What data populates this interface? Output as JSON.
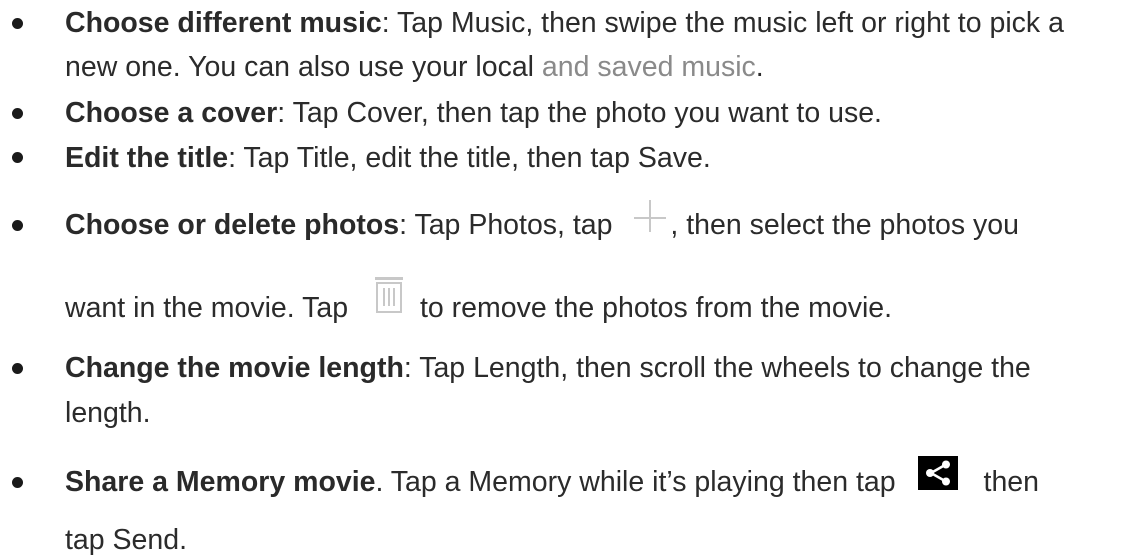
{
  "items": [
    {
      "term": "Choose different music",
      "sep": ":",
      "text": " Tap Music, then swipe the music left or right to pick a",
      "cont_a": "new one. You can also use your local ",
      "cont_gray": "and saved music",
      "cont_b": "."
    },
    {
      "term": "Choose a cover",
      "sep": ":",
      "text": " Tap Cover, then tap the photo you want to use."
    },
    {
      "term": "Edit the title",
      "sep": ":",
      "text": " Tap Title, edit the title, then tap Save."
    },
    {
      "term": "Choose or delete photos",
      "sep": ":",
      "text_a": " Tap Photos, tap ",
      "icon_a": "plus-icon",
      "text_b": ", then select the photos you",
      "cont_a": "want in the movie. Tap ",
      "icon_b": "trash-icon",
      "cont_b": "to remove the photos from the movie."
    },
    {
      "term": "Change the movie length",
      "sep": ":",
      "text": " Tap Length, then scroll the wheels to change the",
      "cont": "length."
    },
    {
      "term": "Share a Memory movie",
      "sep": ".",
      "text_a": " Tap a Memory while it’s playing then tap ",
      "icon": "share-icon",
      "text_b": "then",
      "cont": "tap Send."
    }
  ],
  "colors": {
    "text": "#2b2b2b",
    "gray_text": "#8a8a8a",
    "bullet": "#1a1a1a",
    "icon_gray": "#c8c8c8",
    "share_icon_bg": "#000000"
  }
}
